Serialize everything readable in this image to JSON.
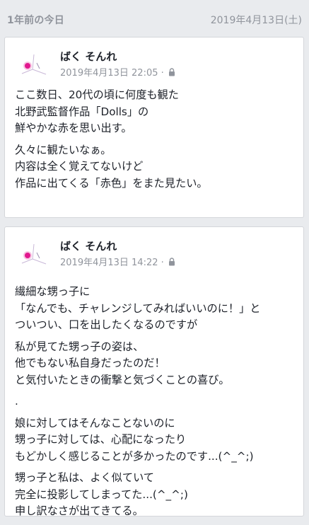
{
  "header": {
    "title": "1年前の今日",
    "date": "2019年4月13日(土)"
  },
  "posts": [
    {
      "author": "ばく そんれ",
      "timestamp": "2019年4月13日 22:05 · ",
      "privacy_icon": "lock-icon",
      "paragraphs": [
        [
          "ここ数日、20代の頃に何度も観た",
          "北野武監督作品「Dolls」の",
          "鮮やかな赤を思い出す。"
        ],
        [
          "久々に観たいなぁ。",
          "内容は全く覚えてないけど",
          "作品に出てくる「赤色」をまた見たい。"
        ]
      ]
    },
    {
      "author": "ばく そんれ",
      "timestamp": "2019年4月13日 14:22 · ",
      "privacy_icon": "lock-icon",
      "paragraphs": [
        [
          "繊細な甥っ子に",
          "「なんでも、チャレンジしてみればいいのに！」と",
          "ついつい、口を出したくなるのですが"
        ],
        [
          "私が見てた甥っ子の姿は、",
          "他でもない私自身だったのだ！",
          "と気付いたときの衝撃と気づくことの喜び。"
        ],
        [
          "."
        ],
        [
          "娘に対してはそんなことないのに",
          "甥っ子に対しては、心配になったり",
          "もどかしく感じることが多かったのです...(^_^;)"
        ],
        [
          "甥っ子と私は、よく似ていて",
          "完全に投影してしまってた...(^_^;)",
          "申し訳なさが出てきてる。"
        ]
      ]
    }
  ]
}
